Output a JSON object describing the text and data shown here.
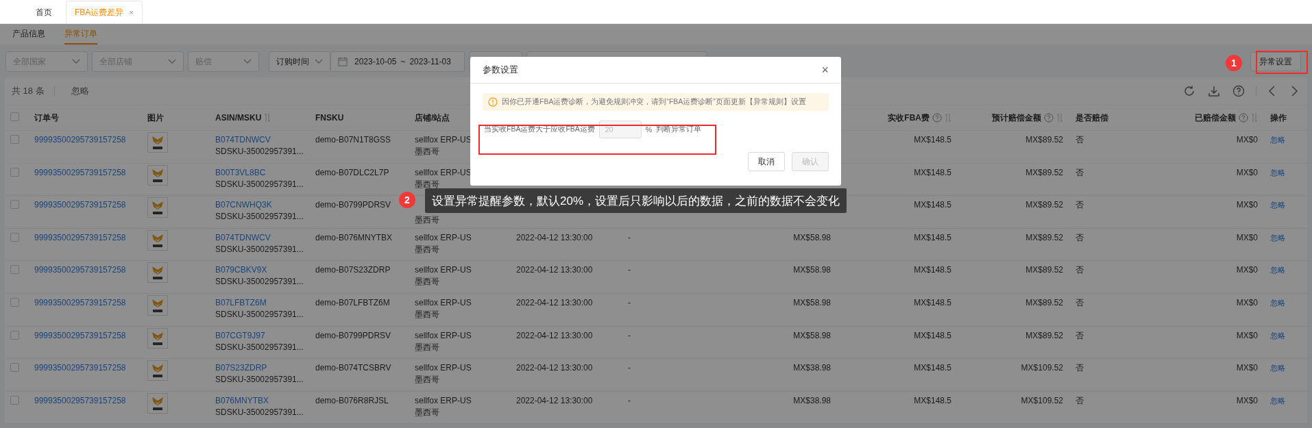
{
  "top_tabs": [
    {
      "label": "首页",
      "selected": false,
      "closable": false
    },
    {
      "label": "FBA运费差异",
      "selected": true,
      "closable": true,
      "close": "×"
    }
  ],
  "sub_tabs": [
    {
      "label": "产品信息",
      "selected": false
    },
    {
      "label": "异常订单",
      "selected": true
    }
  ],
  "filters": [
    {
      "kind": "select",
      "placeholder": "全部国家"
    },
    {
      "kind": "select",
      "placeholder": "全部店铺"
    },
    {
      "kind": "select",
      "placeholder": "赔偿"
    },
    {
      "kind": "select",
      "value": "订购时间"
    },
    {
      "kind": "daterange",
      "start": "2023-10-05",
      "separator": "~",
      "end": "2023-11-03"
    },
    {
      "kind": "field"
    },
    {
      "kind": "field"
    }
  ],
  "settings_button": "异常设置",
  "toolbar": {
    "total": "共 18 条",
    "ignore": "忽略"
  },
  "table": {
    "columns": [
      {
        "label": "订单号",
        "sortable": false,
        "help": false
      },
      {
        "label": "图片",
        "sortable": false,
        "help": false
      },
      {
        "label": "ASIN/MSKU",
        "sortable": true,
        "help": false
      },
      {
        "label": "FNSKU",
        "sortable": false,
        "help": false
      },
      {
        "label": "店铺/站点",
        "sortable": false,
        "help": false
      },
      {
        "label": "实收FBA费",
        "sortable": true,
        "help": true
      },
      {
        "label": "预计赔偿金额",
        "sortable": true,
        "help": true
      },
      {
        "label": "是否赔偿",
        "sortable": false,
        "help": false
      },
      {
        "label": "已赔偿金额",
        "sortable": true,
        "help": true
      },
      {
        "label": "操作",
        "sortable": false,
        "help": false
      }
    ],
    "header_checked": false,
    "rows": [
      {
        "checked": false,
        "order": "99993500295739157258",
        "asin": "B074TDNWCV",
        "msku": "SDSKU-35002957391...",
        "fnsku": "demo-B07N1T8GSS",
        "shop": "sellfox ERP-US",
        "site": "墨西哥",
        "actual_fee": "MX$148.5",
        "estimate": "MX$89.52",
        "compensated": "否",
        "paid": "MX$0",
        "action": "忽略"
      },
      {
        "checked": false,
        "order": "99993500295739157258",
        "asin": "B00T3VL8BC",
        "msku": "SDSKU-35002957391...",
        "fnsku": "demo-B07DLC2L7P",
        "shop": "sellfox ERP-US",
        "site": "墨西哥",
        "actual_fee": "MX$148.5",
        "estimate": "MX$89.52",
        "compensated": "否",
        "paid": "MX$0",
        "action": "忽略"
      },
      {
        "checked": false,
        "order": "99993500295739157258",
        "asin": "B07CNWHQ3K",
        "msku": "SDSKU-35002957391...",
        "fnsku": "demo-B0799PDRSV",
        "site": "墨西哥",
        "actual_fee": "MX$148.5",
        "estimate": "MX$89.52",
        "compensated": "否",
        "paid": "MX$0",
        "action": "忽略"
      },
      {
        "checked": false,
        "order": "99993500295739157258",
        "asin": "B074TDNWCV",
        "msku": "SDSKU-35002957391...",
        "fnsku": "demo-B076MNYTBX",
        "shop": "sellfox ERP-US",
        "site": "墨西哥",
        "date": "2022-04-12 13:30:00",
        "dash": "-",
        "fee": "MX$58.98",
        "actual_fee": "MX$148.5",
        "estimate": "MX$89.52",
        "compensated": "否",
        "paid": "MX$0",
        "action": "忽略"
      },
      {
        "checked": false,
        "order": "99993500295739157258",
        "asin": "B079CBKV9X",
        "msku": "SDSKU-35002957391...",
        "fnsku": "demo-B07S23ZDRP",
        "shop": "sellfox ERP-US",
        "site": "墨西哥",
        "date": "2022-04-12 13:30:00",
        "dash": "-",
        "fee": "MX$58.98",
        "actual_fee": "MX$148.5",
        "estimate": "MX$89.52",
        "compensated": "否",
        "paid": "MX$0",
        "action": "忽略"
      },
      {
        "checked": false,
        "order": "99993500295739157258",
        "asin": "B07LFBTZ6M",
        "msku": "SDSKU-35002957391...",
        "fnsku": "demo-B07LFBTZ6M",
        "shop": "sellfox ERP-US",
        "site": "墨西哥",
        "date": "2022-04-12 13:30:00",
        "dash": "-",
        "fee": "MX$58.98",
        "actual_fee": "MX$148.5",
        "estimate": "MX$89.52",
        "compensated": "否",
        "paid": "MX$0",
        "action": "忽略"
      },
      {
        "checked": false,
        "order": "99993500295739157258",
        "asin": "B07CGT9J97",
        "msku": "SDSKU-35002957391...",
        "fnsku": "demo-B0799PDRSV",
        "shop": "sellfox ERP-US",
        "site": "墨西哥",
        "date": "2022-04-12 13:30:00",
        "dash": "-",
        "fee": "MX$58.98",
        "actual_fee": "MX$148.5",
        "estimate": "MX$89.52",
        "compensated": "否",
        "paid": "MX$0",
        "action": "忽略"
      },
      {
        "checked": false,
        "order": "99993500295739157258",
        "asin": "B07S23ZDRP",
        "msku": "SDSKU-35002957391...",
        "fnsku": "demo-B074TCSBRV",
        "shop": "sellfox ERP-US",
        "site": "墨西哥",
        "date": "2022-04-12 13:30:00",
        "dash": "-",
        "fee": "MX$38.98",
        "actual_fee": "MX$148.5",
        "estimate": "MX$109.52",
        "compensated": "否",
        "paid": "MX$0",
        "action": "忽略"
      },
      {
        "checked": false,
        "order": "99993500295739157258",
        "asin": "B076MNYTBX",
        "msku": "SDSKU-35002957391...",
        "fnsku": "demo-B076R8RJSL",
        "shop": "sellfox ERP-US",
        "site": "墨西哥",
        "date": "2022-04-12 13:30:00",
        "dash": "-",
        "fee": "MX$38.98",
        "actual_fee": "MX$148.5",
        "estimate": "MX$109.52",
        "compensated": "否",
        "paid": "MX$0",
        "action": "忽略"
      }
    ]
  },
  "modal": {
    "title": "参数设置",
    "close": "×",
    "alert": "因你已开通FBA运费诊断，为避免规则冲突，请到“FBA运费诊断”页面更新【异常规则】设置",
    "rule_label": "当实收FBA运费大于应收FBA运费",
    "input": {
      "value": "20",
      "disabled": true
    },
    "unit": "%",
    "rule_suffix": "判断异常订单",
    "buttons": [
      {
        "label": "取消",
        "disabled": false
      },
      {
        "label": "确认",
        "disabled": true
      }
    ]
  },
  "annotations": [
    {
      "kind": "badge",
      "number": "1"
    },
    {
      "kind": "callout",
      "number": "2",
      "text": "设置异常提醒参数，默认20%，设置后只影响以后的数据，之前的数据不会变化"
    }
  ]
}
